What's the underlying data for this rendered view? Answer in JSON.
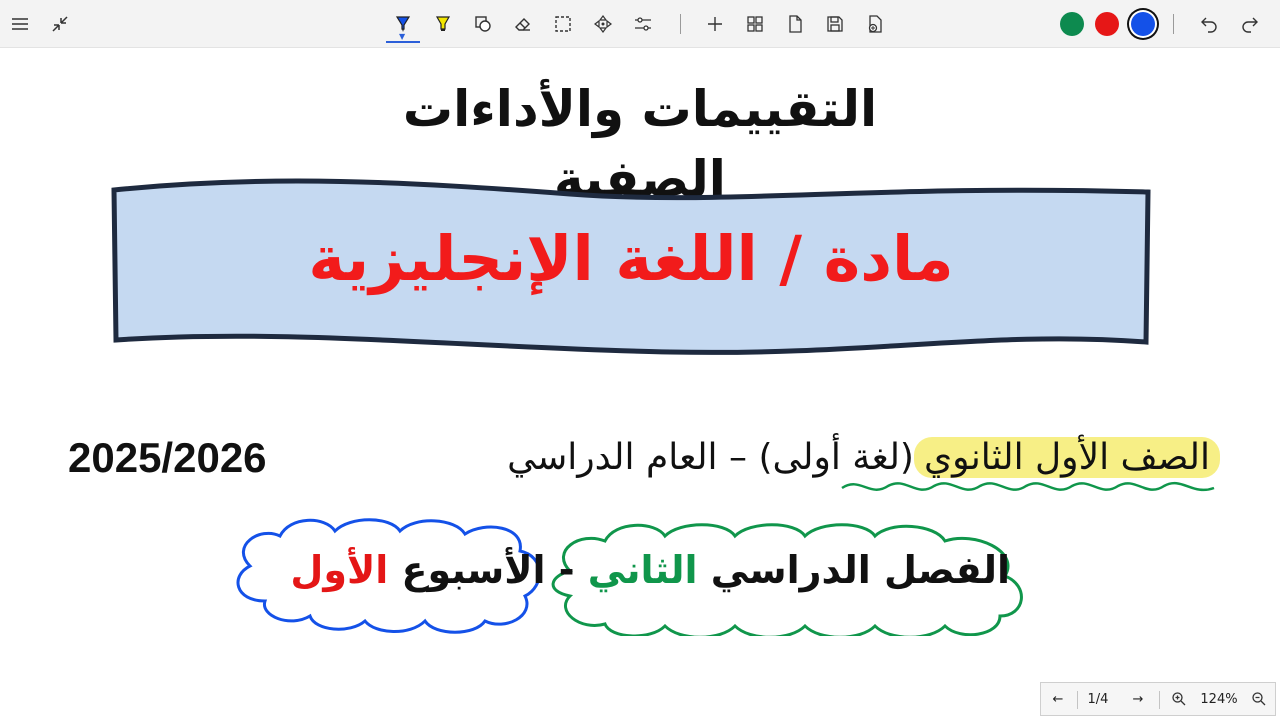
{
  "toolbar": {
    "left_tools": [
      {
        "name": "menu-icon"
      },
      {
        "name": "collapse-icon"
      }
    ],
    "center_tools": [
      {
        "name": "pen-tool-icon",
        "active": true
      },
      {
        "name": "highlighter-icon"
      },
      {
        "name": "shape-icon"
      },
      {
        "name": "eraser-icon"
      },
      {
        "name": "lasso-select-icon"
      },
      {
        "name": "move-icon"
      },
      {
        "name": "settings-sliders-icon"
      },
      {
        "name": "add-icon"
      },
      {
        "name": "grid-icon"
      },
      {
        "name": "page-icon"
      },
      {
        "name": "save-icon"
      },
      {
        "name": "save-as-icon"
      }
    ],
    "colors": [
      {
        "name": "green",
        "hex": "#0d8a4f"
      },
      {
        "name": "red",
        "hex": "#e61717"
      },
      {
        "name": "blue",
        "hex": "#1451e8",
        "selected": true
      }
    ],
    "history": [
      {
        "name": "undo-icon"
      },
      {
        "name": "redo-icon"
      }
    ]
  },
  "content": {
    "title": "التقييمات والأداءات الصفية",
    "subject": "مادة / اللغة الإنجليزية",
    "grade_line": {
      "grade_highlighted": "الصف الأول الثانوي",
      "grade_rest": "(لغة أولى)  – العام الدراسي",
      "year": "2025/2026"
    },
    "term_line": {
      "part1": "الفصل الدراسي",
      "part2": "الثاني",
      "separator": "-",
      "part3": "الأسبوع",
      "part4": "الأول"
    }
  },
  "navigator": {
    "prev": "←",
    "page": "1/4",
    "next": "→",
    "zoom": "124%"
  },
  "colors": {
    "banner_fill": "#c5d9f1",
    "banner_stroke": "#1e2a3f",
    "subject_text": "#f21b1b",
    "highlight": "#f7ef86",
    "green_ink": "#10964b",
    "blue_ink": "#1451e8"
  }
}
